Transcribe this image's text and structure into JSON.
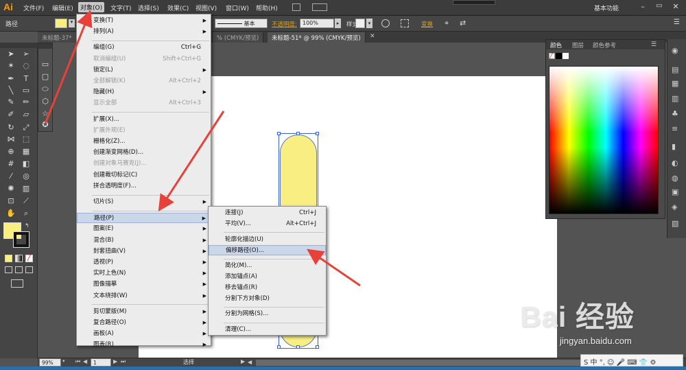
{
  "app": {
    "logo": "Ai",
    "workspace": "基本功能"
  },
  "menubar": [
    "文件(F)",
    "编辑(E)",
    "对象(O)",
    "文字(T)",
    "选择(S)",
    "效果(C)",
    "视图(V)",
    "窗口(W)",
    "帮助(H)"
  ],
  "control": {
    "label": "路径",
    "stroke_style": "基本",
    "opacity_label": "不透明度:",
    "opacity_value": "100%",
    "style_label": "样式:",
    "transform": "变换"
  },
  "tabs": [
    "未标题-37*",
    "% (CMYK/预览)",
    "未标题-51* @ 99% (CMYK/预览)"
  ],
  "color_panel": {
    "tabs": [
      "颜色",
      "图层",
      "颜色参考"
    ]
  },
  "object_menu": [
    {
      "label": "变换(T)",
      "sub": true
    },
    {
      "label": "排列(A)",
      "sub": true
    },
    {
      "sep": true
    },
    {
      "label": "编组(G)",
      "shortcut": "Ctrl+G"
    },
    {
      "label": "取消编组(U)",
      "shortcut": "Shift+Ctrl+G",
      "disabled": true
    },
    {
      "label": "锁定(L)",
      "sub": true
    },
    {
      "label": "全部解锁(K)",
      "shortcut": "Alt+Ctrl+2",
      "disabled": true
    },
    {
      "label": "隐藏(H)",
      "sub": true
    },
    {
      "label": "显示全部",
      "shortcut": "Alt+Ctrl+3",
      "disabled": true
    },
    {
      "sep": true
    },
    {
      "label": "扩展(X)..."
    },
    {
      "label": "扩展外观(E)",
      "disabled": true
    },
    {
      "label": "栅格化(Z)..."
    },
    {
      "label": "创建渐变网格(D)..."
    },
    {
      "label": "创建对象马赛克(J)...",
      "disabled": true
    },
    {
      "label": "创建裁切标记(C)"
    },
    {
      "label": "拼合透明度(F)..."
    },
    {
      "sep": true
    },
    {
      "label": "切片(S)",
      "sub": true
    },
    {
      "sep": true
    },
    {
      "label": "路径(P)",
      "sub": true,
      "highlight": true
    },
    {
      "label": "图案(E)",
      "sub": true
    },
    {
      "label": "混合(B)",
      "sub": true
    },
    {
      "label": "封套扭曲(V)",
      "sub": true
    },
    {
      "label": "透视(P)",
      "sub": true
    },
    {
      "label": "实时上色(N)",
      "sub": true
    },
    {
      "label": "图像描摹",
      "sub": true
    },
    {
      "label": "文本绕排(W)",
      "sub": true
    },
    {
      "sep": true
    },
    {
      "label": "剪切蒙版(M)",
      "sub": true
    },
    {
      "label": "复合路径(O)",
      "sub": true
    },
    {
      "label": "画板(A)",
      "sub": true
    },
    {
      "label": "图表(R)",
      "sub": true
    }
  ],
  "path_submenu": [
    {
      "label": "连接(J)",
      "shortcut": "Ctrl+J"
    },
    {
      "label": "平均(V)...",
      "shortcut": "Alt+Ctrl+J"
    },
    {
      "sep": true
    },
    {
      "label": "轮廓化描边(U)"
    },
    {
      "label": "偏移路径(O)...",
      "highlight": true
    },
    {
      "sep": true
    },
    {
      "label": "简化(M)..."
    },
    {
      "label": "添加锚点(A)"
    },
    {
      "label": "移去锚点(R)"
    },
    {
      "label": "分割下方对象(D)"
    },
    {
      "sep": true
    },
    {
      "label": "分割为网格(S)..."
    },
    {
      "sep": true
    },
    {
      "label": "清理(C)..."
    }
  ],
  "status": {
    "zoom": "99%",
    "page": "1",
    "tool": "选择"
  },
  "watermark": {
    "logo": "Bai 经验",
    "url": "jingyan.baidu.com"
  },
  "ime": "S 中 °, ☺ 🎤 ⌨ 👕 ⚙",
  "colors": {
    "fill": "#f9ee82",
    "accent": "#e8413a",
    "selection": "#3a5fcf"
  }
}
